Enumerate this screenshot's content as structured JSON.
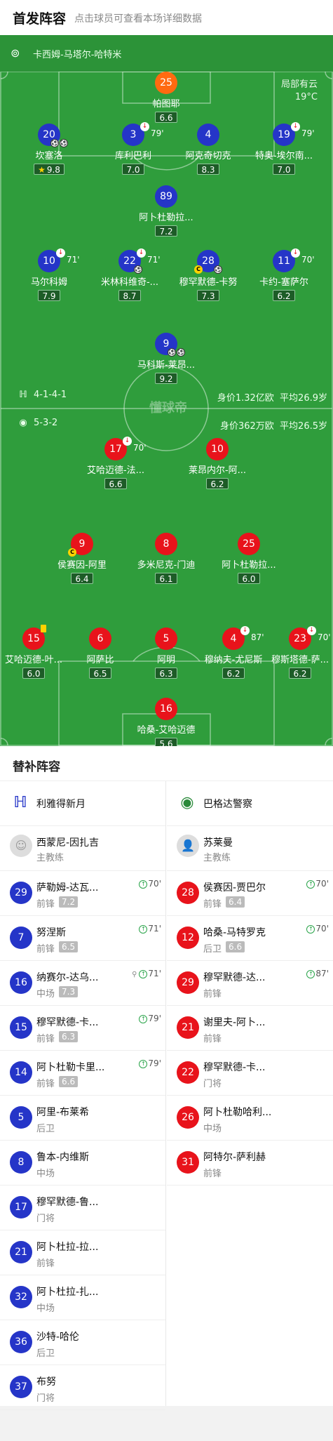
{
  "header": {
    "title": "首发阵容",
    "hint": "点击球员可查看本场详细数据"
  },
  "referee": {
    "name": "卡西姆-马塔尔-哈特米"
  },
  "weather": {
    "condition": "局部有云",
    "temp": "19°C"
  },
  "home_info": {
    "formation": "4-1-4-1",
    "value": "身价1.32亿欧",
    "age": "平均26.9岁"
  },
  "away_info": {
    "formation": "5-3-2",
    "value": "身价362万欧",
    "age": "平均26.5岁"
  },
  "watermark": "懂球帝",
  "home_players": [
    {
      "num": "25",
      "name": "帕图耶",
      "rating": "6.6"
    },
    {
      "num": "20",
      "name": "坎塞洛",
      "rating": "9.8",
      "star": "★"
    },
    {
      "num": "3",
      "name": "库利巴利",
      "rating": "7.0",
      "sub": "79'"
    },
    {
      "num": "4",
      "name": "阿克奇切克",
      "rating": "8.3"
    },
    {
      "num": "19",
      "name": "特奥-埃尔南...",
      "rating": "7.0",
      "sub": "79'"
    },
    {
      "num": "89",
      "name": "阿卜杜勒拉...",
      "rating": "7.2"
    },
    {
      "num": "10",
      "name": "马尔科姆",
      "rating": "7.9",
      "sub": "71'"
    },
    {
      "num": "22",
      "name": "米林科维奇-...",
      "rating": "8.7",
      "sub": "71'"
    },
    {
      "num": "28",
      "name": "穆罕默德-卡努",
      "rating": "7.3"
    },
    {
      "num": "11",
      "name": "卡约-塞萨尔",
      "rating": "6.2",
      "sub": "70'"
    },
    {
      "num": "9",
      "name": "马科斯-莱昂...",
      "rating": "9.2"
    }
  ],
  "away_players": [
    {
      "num": "17",
      "name": "艾哈迈德-法...",
      "rating": "6.6",
      "sub": "70'"
    },
    {
      "num": "10",
      "name": "莱昂内尔-阿...",
      "rating": "6.2"
    },
    {
      "num": "9",
      "name": "侯赛因-阿里",
      "rating": "6.4"
    },
    {
      "num": "8",
      "name": "多米尼克-门迪",
      "rating": "6.1"
    },
    {
      "num": "25",
      "name": "阿卜杜勒拉...",
      "rating": "6.0"
    },
    {
      "num": "15",
      "name": "艾哈迈德-叶...",
      "rating": "6.0"
    },
    {
      "num": "6",
      "name": "阿萨比",
      "rating": "6.5"
    },
    {
      "num": "5",
      "name": "阿明",
      "rating": "6.3"
    },
    {
      "num": "4",
      "name": "穆纳夫-尤尼斯",
      "rating": "6.2",
      "sub": "87'"
    },
    {
      "num": "23",
      "name": "穆斯塔德-萨...",
      "rating": "6.2",
      "sub": "70'"
    },
    {
      "num": "16",
      "name": "哈桑-艾哈迈德",
      "rating": "5.6"
    }
  ],
  "subs": {
    "title": "替补阵容",
    "home": {
      "team": "利雅得新月",
      "coach": "西蒙尼-因扎吉",
      "coach_role": "主教练",
      "list": [
        {
          "num": "29",
          "name": "萨勒姆-达瓦...",
          "pos": "前锋",
          "rating": "7.2",
          "in": "70'"
        },
        {
          "num": "7",
          "name": "努涅斯",
          "pos": "前锋",
          "rating": "6.5",
          "in": "71'"
        },
        {
          "num": "16",
          "name": "纳赛尔-达乌...",
          "pos": "中场",
          "rating": "7.3",
          "in": "71'"
        },
        {
          "num": "15",
          "name": "穆罕默德-卡...",
          "pos": "前锋",
          "rating": "6.3",
          "in": "79'"
        },
        {
          "num": "14",
          "name": "阿卜杜勒卡里...",
          "pos": "前锋",
          "rating": "6.6",
          "in": "79'"
        },
        {
          "num": "5",
          "name": "阿里-布莱希",
          "pos": "后卫"
        },
        {
          "num": "8",
          "name": "鲁本-内维斯",
          "pos": "中场"
        },
        {
          "num": "17",
          "name": "穆罕默德-鲁...",
          "pos": "门将"
        },
        {
          "num": "21",
          "name": "阿卜杜拉-拉...",
          "pos": "前锋"
        },
        {
          "num": "32",
          "name": "阿卜杜拉-扎...",
          "pos": "中场"
        },
        {
          "num": "36",
          "name": "沙特-哈伦",
          "pos": "后卫"
        },
        {
          "num": "37",
          "name": "布努",
          "pos": "门将"
        }
      ]
    },
    "away": {
      "team": "巴格达警察",
      "coach": "苏莱曼",
      "coach_role": "主教练",
      "list": [
        {
          "num": "28",
          "name": "侯赛因-贾巴尔",
          "pos": "前锋",
          "rating": "6.4",
          "in": "70'"
        },
        {
          "num": "12",
          "name": "哈桑-马特罗克",
          "pos": "后卫",
          "rating": "6.6",
          "in": "70'"
        },
        {
          "num": "29",
          "name": "穆罕默德-达...",
          "pos": "前锋",
          "in": "87'"
        },
        {
          "num": "21",
          "name": "谢里夫-阿卜...",
          "pos": "前锋"
        },
        {
          "num": "22",
          "name": "穆罕默德-卡...",
          "pos": "门将"
        },
        {
          "num": "26",
          "name": "阿卜杜勒哈利...",
          "pos": "中场"
        },
        {
          "num": "31",
          "name": "阿特尔-萨利赫",
          "pos": "前锋"
        }
      ]
    }
  },
  "colors": {
    "pitch": "#2f9d3c",
    "home": "#2535c8",
    "away": "#e8131b",
    "gk_home": "#ff6a10"
  }
}
